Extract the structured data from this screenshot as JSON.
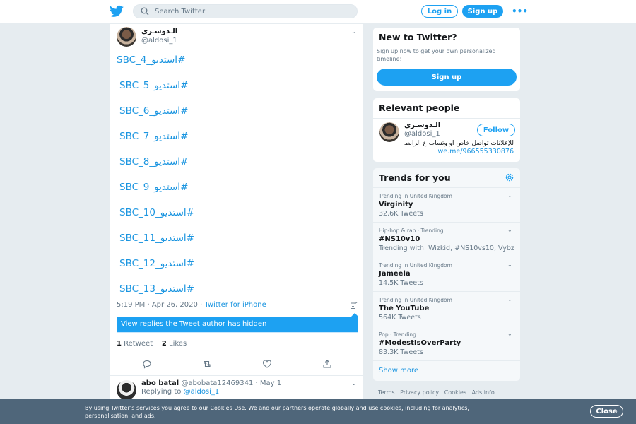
{
  "header": {
    "search_placeholder": "Search Twitter",
    "login_label": "Log in",
    "signup_label": "Sign up",
    "more_label": "•••"
  },
  "tweet": {
    "author_name": "الـدوسـري",
    "author_handle": "@aldosi_1",
    "hashtags": [
      "#استديو_SBC_4",
      "#استديو_SBC_5",
      "#استديو_SBC_6",
      "#استديو_SBC_7",
      "#استديو_SBC_8",
      "#استديو_SBC_9",
      "#استديو_SBC_10",
      "#استديو_SBC_11",
      "#استديو_SBC_12",
      "#استديو_SBC_13"
    ],
    "time": "5:19 PM · Apr 26, 2020 · ",
    "source": "Twitter for iPhone",
    "hidden_replies_label": "View replies the Tweet author has hidden",
    "retweet_count": "1",
    "retweet_label": "Retweet",
    "like_count": "2",
    "like_label": "Likes"
  },
  "reply": {
    "name": "abo batal",
    "handle_date": "@abobata12469341 · May 1",
    "replying_label": "Replying to ",
    "replying_handle": "@aldosi_1"
  },
  "sidebar": {
    "new_title": "New to Twitter?",
    "new_sub": "Sign up now to get your own personalized timeline!",
    "new_signup": "Sign up",
    "relevant_title": "Relevant people",
    "rp_name": "الـدوسـري",
    "rp_handle": "@aldosi_1",
    "follow_label": "Follow",
    "rp_bio": "للإعلانات تواصل خاص او وتساب ع الرابط",
    "rp_link": "we.me/966555330876",
    "trends_title": "Trends for you",
    "trends": [
      {
        "context": "Trending in United Kingdom",
        "name": "Virginity",
        "stat": "32.6K Tweets"
      },
      {
        "context": "Hip-hop & rap · Trending",
        "name": "#NS10v10",
        "stat": "Trending with: Wizkid, #NS10vs10, Vybz"
      },
      {
        "context": "Trending in United Kingdom",
        "name": "Jameela",
        "stat": "14.5K Tweets"
      },
      {
        "context": "Trending in United Kingdom",
        "name": "The YouTube",
        "stat": "564K Tweets"
      },
      {
        "context": "Pop · Trending",
        "name": "#ModestIsOverParty",
        "stat": "83.3K Tweets"
      }
    ],
    "show_more": "Show more"
  },
  "footer": {
    "links": [
      "Terms",
      "Privacy policy",
      "Cookies",
      "Ads info"
    ]
  },
  "cookie": {
    "text_before": "By using Twitter’s services you agree to our ",
    "link": "Cookies Use",
    "text_after": ". We and our partners operate globally and use cookies, including for analytics, personalisation, and ads.",
    "close_label": "Close"
  },
  "colors": {
    "accent": "#1da1f2",
    "link": "#1b95e0",
    "cookie_bg": "#4f667a",
    "page_bg": "#e6ecf0"
  }
}
